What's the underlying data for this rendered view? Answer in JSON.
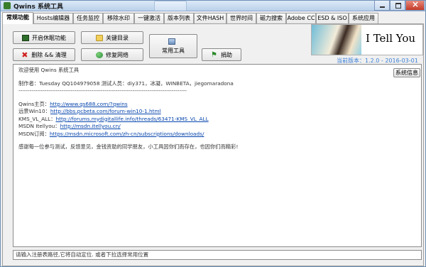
{
  "window": {
    "title": "Qwins 系统工具"
  },
  "tabs": [
    {
      "label": "常规功能",
      "active": true
    },
    {
      "label": "Hosts编辑器"
    },
    {
      "label": "任务监控"
    },
    {
      "label": "移除水印"
    },
    {
      "label": "一键激活"
    },
    {
      "label": "版本列表"
    },
    {
      "label": "文件HASH"
    },
    {
      "label": "世界时间"
    },
    {
      "label": "磁力搜索"
    },
    {
      "label": "Adobe CC"
    },
    {
      "label": "ESD & ISO"
    },
    {
      "label": "系统应用"
    }
  ],
  "buttons": {
    "hibernate": "开启休眠功能",
    "key_dir": "关键目录",
    "common_tools": "常用工具",
    "delete_cleanup": "删除 && 清理",
    "repair_network": "修复网络",
    "donate": "捐助",
    "sysinfo": "系统信息"
  },
  "banner": {
    "brand": "I Tell You",
    "version": "当前版本：1.2.0 - 2016-03-01"
  },
  "content": {
    "welcome": "欢迎使用 Qwins 系统工具",
    "author": "制作者：Tuesday QQ104979058 测试人员：diy371，冰凝，WINBETA，jiegomaradona",
    "separator": "------------------------------------------------------------------------------------------",
    "links": [
      {
        "label": "Qwins主页：",
        "url": "http://www.qs688.com/?qwins"
      },
      {
        "label": "远景Win10：",
        "url": "http://bbs.pcbeta.com/forum-win10-1.html"
      },
      {
        "label": "KMS_VL_ALL：",
        "url": "http://forums.mydigitallife.info/threads/63471-KMS_VL_ALL"
      },
      {
        "label": "MSDN Itellyou：",
        "url": "http://msdn.itellyou.cn/"
      },
      {
        "label": "MSDN订阅：",
        "url": "https://msdn.microsoft.com/zh-cn/subscriptions/downloads/"
      }
    ],
    "thanks": "感谢每一位参与测试，反馈意见，金钱资助的同学朋友，小工具因你们而存在，也因你们而精彩!"
  },
  "status": {
    "text": "请输入注册表路径,它将自动定位. 或者下拉选择常用位置"
  },
  "icons": [
    "app-icon",
    "monitor-icon",
    "folder-icon",
    "delete-x-icon",
    "globe-icon",
    "tools-icon",
    "flag-icon"
  ]
}
